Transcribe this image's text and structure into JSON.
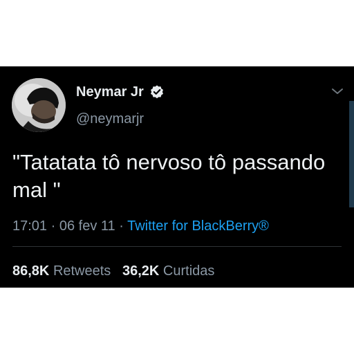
{
  "tweet": {
    "author_name": "Neymar Jr",
    "handle": "@neymarjr",
    "text": "\"Tatatata tô nervoso tô passando mal \"",
    "time": "17:01",
    "separator": "·",
    "date": "06 fev 11",
    "source": "Twitter for BlackBerry®",
    "retweets_count": "86,8K",
    "retweets_label": "Retweets",
    "likes_count": "36,2K",
    "likes_label": "Curtidas"
  },
  "icons": {
    "verified": "verified-badge-icon",
    "menu": "chevron-down-icon"
  },
  "colors": {
    "background": "#000000",
    "text_primary": "#e8ecef",
    "text_secondary": "#8b98a5",
    "link": "#1da1f2"
  }
}
